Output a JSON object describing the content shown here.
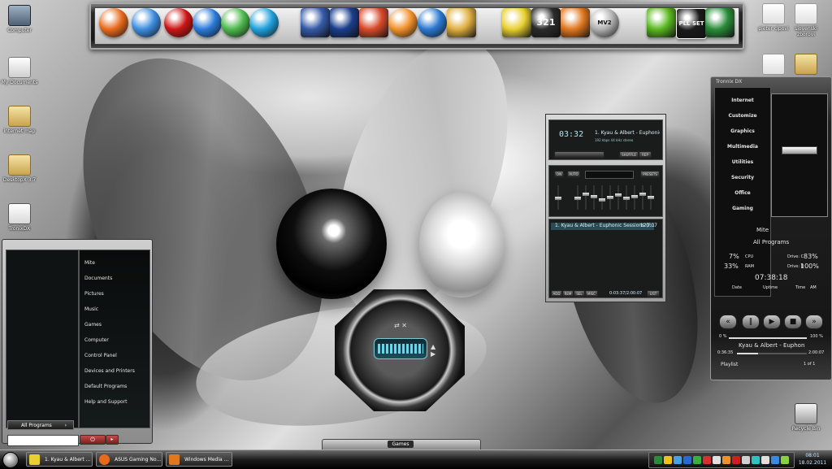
{
  "desktop": {
    "left_icons": [
      {
        "label": "Computer",
        "icon": "computer-icon"
      },
      {
        "label": "My Documents",
        "icon": "documents-icon"
      },
      {
        "label": "internet map",
        "icon": "folder-icon"
      },
      {
        "label": "DesktopX 3.7",
        "icon": "folder-icon"
      },
      {
        "label": "TronixDX",
        "icon": "app-icon"
      }
    ],
    "right_icons": [
      {
        "label": "pieter cipovi",
        "icon": "document-icon"
      },
      {
        "label": "slovenski zborovi",
        "icon": "document-icon"
      },
      {
        "label": "",
        "icon": "document-icon"
      },
      {
        "label": "",
        "icon": "folder-icon"
      }
    ],
    "recycle_bin": {
      "label": "Recycle Bin",
      "icon": "recycle-bin-icon"
    }
  },
  "dock": {
    "apps": [
      {
        "name": "firefox-icon",
        "color": "#e86a1c"
      },
      {
        "name": "chrome-icon",
        "color": "#3c8dde"
      },
      {
        "name": "opera-icon",
        "color": "#cc1414"
      },
      {
        "name": "internet-explorer-icon",
        "color": "#2a7ad8"
      },
      {
        "name": "messenger-icon",
        "color": "#4cb84c"
      },
      {
        "name": "skype-icon",
        "color": "#1fa0dc"
      },
      {
        "name": "photo-icon",
        "color": "#355aa8"
      },
      {
        "name": "photoshop-icon",
        "color": "#1a3d8c"
      },
      {
        "name": "beach-icon",
        "color": "#d84a2a"
      },
      {
        "name": "info-icon",
        "color": "#f0902a"
      },
      {
        "name": "disc-icon",
        "color": "#2a78d0"
      },
      {
        "name": "paint-icon",
        "color": "#e0b040"
      },
      {
        "name": "winamp-icon",
        "color": "#e8d030"
      },
      {
        "name": "countdown-icon",
        "color": "#2a2a2a",
        "text": "321"
      },
      {
        "name": "media-icon",
        "color": "#e07820"
      },
      {
        "name": "mv2-icon",
        "color": "#b0b0b0",
        "text": "MV2"
      },
      {
        "name": "nvidia-icon",
        "color": "#5ab820"
      },
      {
        "name": "pll-set-icon",
        "color": "#1a1a1a",
        "text": "PLL SET"
      },
      {
        "name": "excel-icon",
        "color": "#2a8c3a"
      }
    ]
  },
  "start_menu": {
    "right_items": [
      "Mite",
      "Documents",
      "Pictures",
      "Music",
      "Games",
      "Computer",
      "Control Panel",
      "Devices and Printers",
      "Default Programs",
      "Help and Support"
    ],
    "all_programs_label": "All Programs",
    "all_programs_arrow": "›",
    "search_placeholder": "",
    "power_symbol": "⏻",
    "power_arrow": "▸"
  },
  "winamp": {
    "time": "03:32",
    "track_title": "1. Kyau & Albert - Euphonic Se",
    "kbps_text": "192 kbps  44 kHz  stereo",
    "playlist_entry": "1. Kyau & Albert - Euphonic Sessions (F...",
    "playlist_duration": "120:07",
    "position_text": "0:03:37/2:00:07",
    "shuffle_label": "SHUFFLE",
    "repeat_label": "REP",
    "eq_on_label": "ON",
    "eq_auto_label": "AUTO",
    "presets_label": "PRESETS",
    "playlist_buttons": [
      "ADD",
      "REM",
      "SEL",
      "MISC",
      "LIST"
    ],
    "eq_band_levels": [
      0.55,
      0.35,
      0.45,
      0.6,
      0.5,
      0.4,
      0.55,
      0.45,
      0.35,
      0.5
    ]
  },
  "media_gadget": {
    "spectrum_label": ""
  },
  "sidebar_gadget": {
    "title": "Tronnix DX",
    "menu": [
      "Internet",
      "Customize",
      "Graphics",
      "Multimedia",
      "Utilities",
      "Security",
      "Office",
      "Gaming"
    ],
    "user": "Mite",
    "all_programs": "All Programs",
    "cpu_pct": "7%",
    "cpu_label": "CPU",
    "ram_pct": "33%",
    "ram_label": "RAM",
    "drive_c_label": "Drive: C",
    "drive_c_pct": "83%",
    "drive_d_label": "Drive: D",
    "drive_d_pct": "100%",
    "uptime": "07:38:18",
    "date_label": "Date",
    "uptime_label": "Uptime",
    "time_label": "Time",
    "ampm": "AM",
    "controls": [
      "«",
      "‖",
      "▶",
      "■",
      "»"
    ],
    "vol_min": "0 %",
    "vol_max": "100 %",
    "volume_level": 1.0,
    "now_playing": "Kyau & Albert - Euphon",
    "elapsed": "0:36:35",
    "total": "2:00:07",
    "track_progress": 0.3,
    "playlist_label": "Playlist",
    "playlist_count": "1 of 1"
  },
  "games_bar": {
    "label": "Games"
  },
  "taskbar": {
    "buttons": [
      {
        "label": "1. Kyau & Albert ...",
        "color": "#e8d030"
      },
      {
        "label": "ASUS Gaming No...",
        "color": "#e86a1c"
      },
      {
        "label": "Windows Media ...",
        "color": "#e07820"
      }
    ],
    "tray_colors": [
      "#2a8c3a",
      "#f0c020",
      "#4aa0e0",
      "#2a6ad0",
      "#38b040",
      "#d83030",
      "#e0e0e0",
      "#f0902a",
      "#cc2020",
      "#d0d0d0",
      "#30c0c0",
      "#e0e0e0",
      "#3a8ae0",
      "#8ad040"
    ],
    "clock_time": "08:01",
    "clock_date": "18.02.2011"
  }
}
